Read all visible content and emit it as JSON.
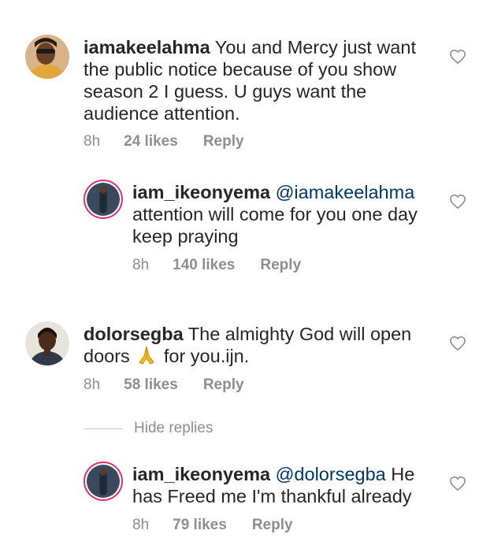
{
  "comments": [
    {
      "username": "iamakeelahma",
      "text": " You and Mercy just want the public notice because of you show season 2 I guess. U guys want the audience attention.",
      "time": "8h",
      "likes": "24 likes",
      "reply": "Reply"
    },
    {
      "username": "iam_ikeonyema",
      "mention": "@iamakeelahma",
      "text": "attention will come for you one day keep praying",
      "time": "8h",
      "likes": "140 likes",
      "reply": "Reply"
    },
    {
      "username": "dolorsegba",
      "text_before_emoji": " The almighty God will open doors ",
      "emoji": "folded-hands",
      "text_after_emoji": " for you.ijn.",
      "time": "8h",
      "likes": "58 likes",
      "reply": "Reply"
    },
    {
      "username": "iam_ikeonyema",
      "mention": "@dolorsegba",
      "text": " He has Freed me I'm thankful already",
      "time": "8h",
      "likes": "79 likes",
      "reply": "Reply"
    }
  ],
  "hide_replies": "Hide replies",
  "icons": {
    "like": "heart-outline-icon"
  },
  "colors": {
    "text": "#262626",
    "muted": "#8e8e8e",
    "mention": "#003569",
    "story_ring": "#e1306c"
  }
}
